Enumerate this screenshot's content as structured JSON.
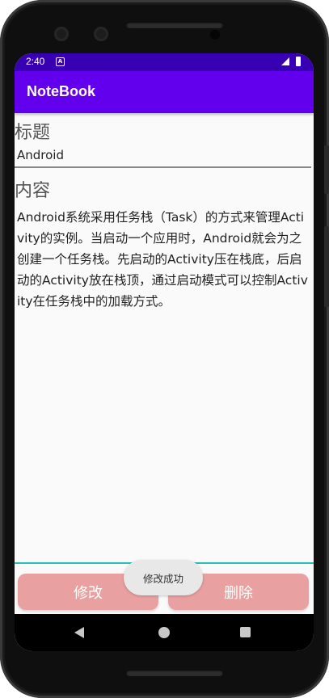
{
  "statusbar": {
    "time": "2:40",
    "notification_icon": "android-notification-icon",
    "signal_icon": "signal-icon",
    "battery_icon": "battery-icon"
  },
  "appbar": {
    "title": "NoteBook"
  },
  "form": {
    "title_label": "标题",
    "title_value": "Android",
    "content_label": "内容",
    "content_value": "Android系统采用任务栈（Task）的方式来管理Activity的实例。当启动一个应用时，Android就会为之创建一个任务栈。先启动的Activity压在栈底，后启动的Activity放在栈顶，通过启动模式可以控制Activity在任务栈中的加载方式。"
  },
  "buttons": {
    "edit": "修改",
    "delete": "删除"
  },
  "toast": {
    "message": "修改成功"
  },
  "colors": {
    "statusbar": "#3700b3",
    "appbar": "#6200ee",
    "button": "#e9a0a0",
    "accent_underline": "#27c0b4"
  },
  "navbar": {
    "back_icon": "back-icon",
    "home_icon": "home-icon",
    "recents_icon": "recents-icon"
  }
}
